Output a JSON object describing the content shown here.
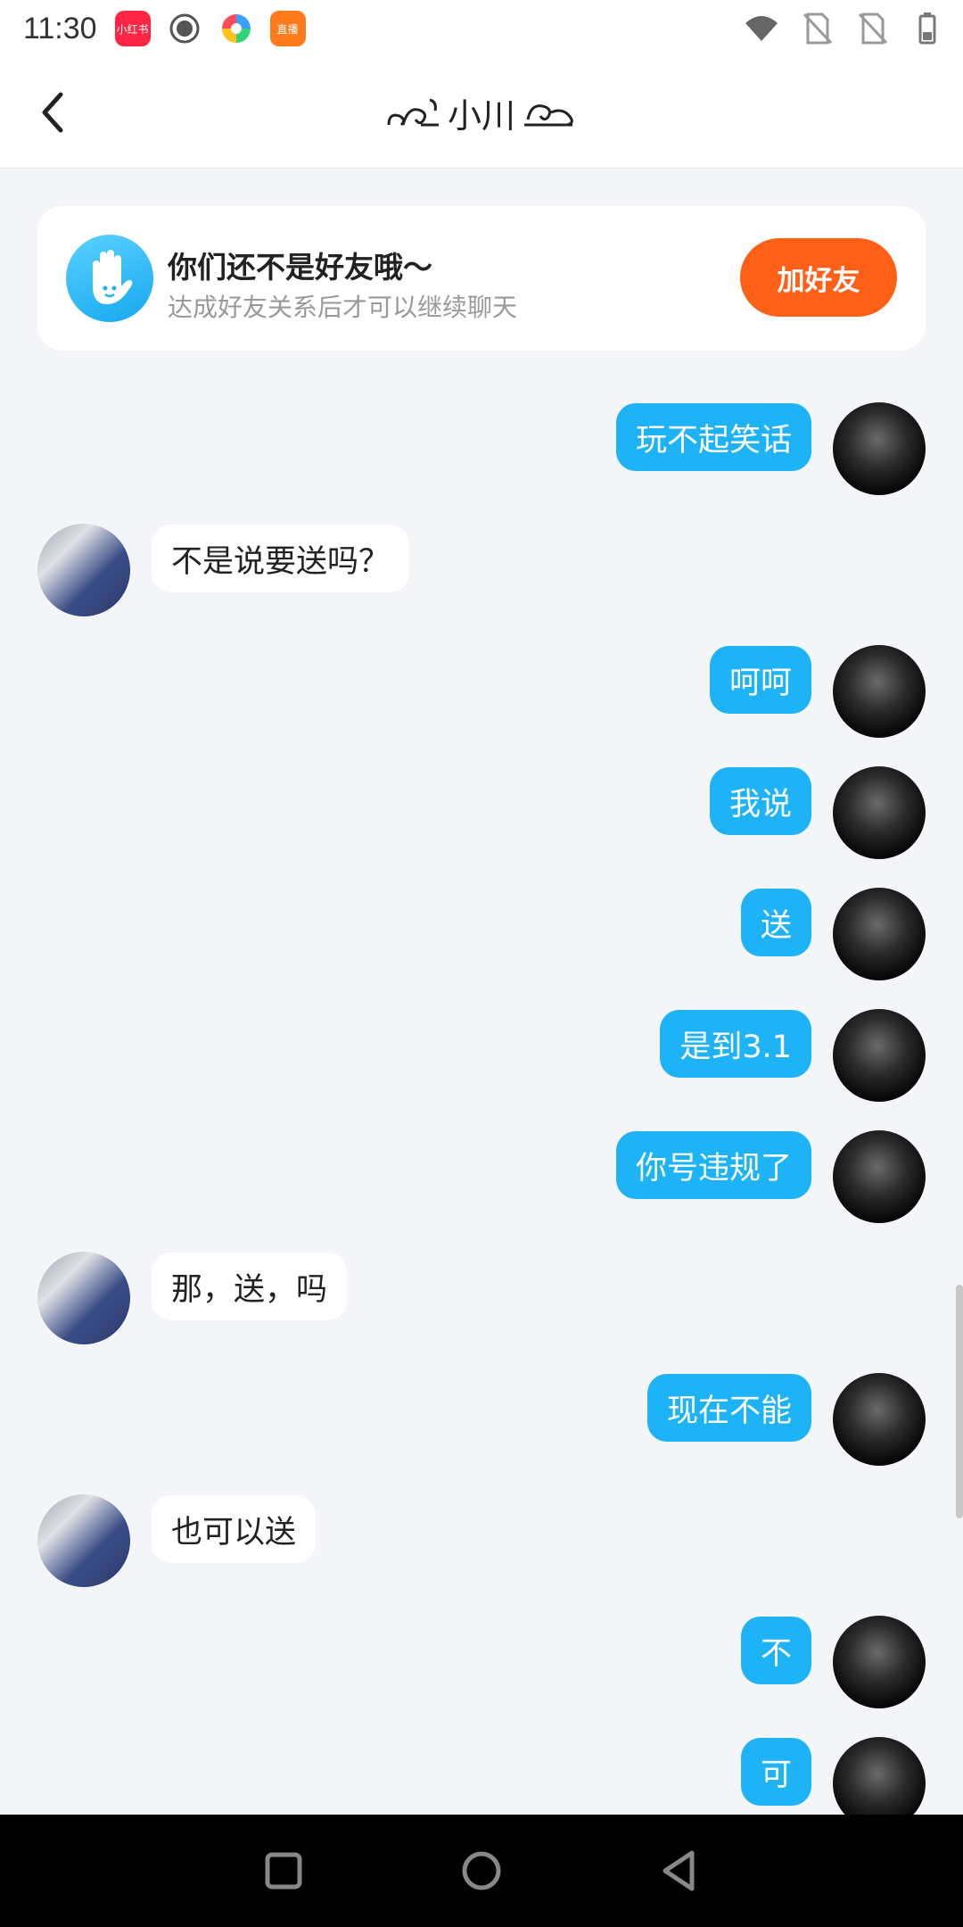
{
  "status_bar": {
    "time": "11:30",
    "app_icons": [
      {
        "name": "xiaohongshu-icon",
        "label": "小红书",
        "color": "#ff2442"
      },
      {
        "name": "record-icon",
        "label": "",
        "color": "#555555"
      },
      {
        "name": "pinwheel-icon",
        "label": "",
        "color": "#3aa0ff"
      },
      {
        "name": "live-app-icon",
        "label": "直播",
        "color": "#ff7a1a"
      }
    ]
  },
  "header": {
    "back_icon": "chevron-left-icon",
    "title": "小川"
  },
  "friend_banner": {
    "title": "你们还不是好友哦～",
    "subtitle": "达成好友关系后才可以继续聊天",
    "button": "加好友",
    "button_color": "#ff6018"
  },
  "messages": [
    {
      "side": "right",
      "text": "玩不起笑话"
    },
    {
      "side": "left",
      "text": "不是说要送吗？"
    },
    {
      "side": "right",
      "text": "呵呵"
    },
    {
      "side": "right",
      "text": "我说"
    },
    {
      "side": "right",
      "text": "送"
    },
    {
      "side": "right",
      "text": "是到3.1"
    },
    {
      "side": "right",
      "text": "你号违规了"
    },
    {
      "side": "left",
      "text": "那，送，吗"
    },
    {
      "side": "right",
      "text": "现在不能"
    },
    {
      "side": "left",
      "text": "也可以送"
    },
    {
      "side": "right",
      "text": "不"
    },
    {
      "side": "right",
      "text": "可"
    }
  ],
  "colors": {
    "accent": "#1eb3f7",
    "background": "#f3f5f8"
  }
}
